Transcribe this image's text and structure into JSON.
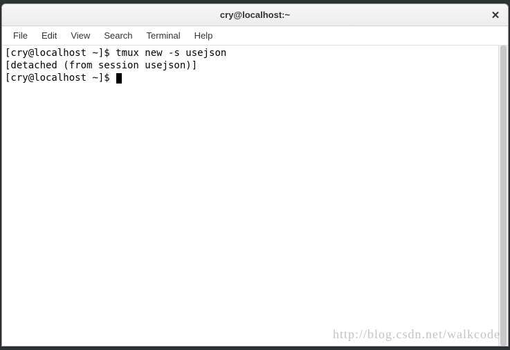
{
  "titlebar": {
    "title": "cry@localhost:~"
  },
  "menubar": {
    "items": [
      {
        "label": "File"
      },
      {
        "label": "Edit"
      },
      {
        "label": "View"
      },
      {
        "label": "Search"
      },
      {
        "label": "Terminal"
      },
      {
        "label": "Help"
      }
    ]
  },
  "terminal": {
    "lines": [
      {
        "prompt": "[cry@localhost ~]$ ",
        "command": "tmux new -s usejson"
      },
      {
        "text": "[detached (from session usejson)]"
      },
      {
        "prompt": "[cry@localhost ~]$ ",
        "command": ""
      }
    ]
  },
  "watermark": "http://blog.csdn.net/walkcode"
}
